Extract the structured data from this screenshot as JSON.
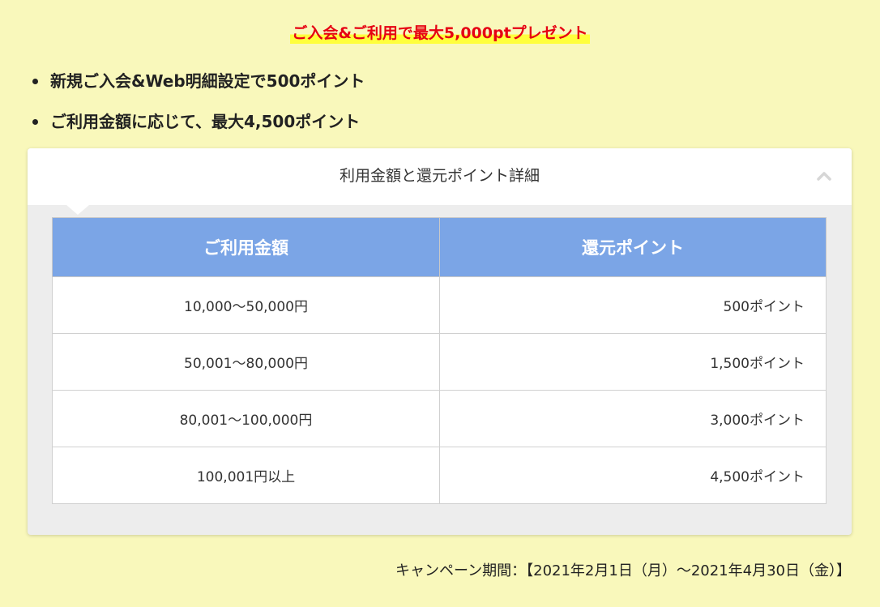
{
  "headline": "ご入会&ご利用で最大5,000ptプレゼント",
  "bullets": [
    "新規ご入会&Web明細設定で500ポイント",
    "ご利用金額に応じて、最大4,500ポイント"
  ],
  "accordion": {
    "title": "利用金額と還元ポイント詳細",
    "icon": "chevron-up-icon",
    "expanded": true
  },
  "table": {
    "headers": [
      "ご利用金額",
      "還元ポイント"
    ],
    "rows": [
      [
        "10,000～50,000円",
        "500ポイント"
      ],
      [
        "50,001～80,000円",
        "1,500ポイント"
      ],
      [
        "80,001～100,000円",
        "3,000ポイント"
      ],
      [
        "100,001円以上",
        "4,500ポイント"
      ]
    ]
  },
  "campaign_period": "キャンペーン期間：【2021年2月1日（月）～2021年4月30日（金）】",
  "colors": {
    "background": "#f9f8bb",
    "headline": "#e60012",
    "highlight": "#ffff3c",
    "table_header": "#7ba5e6",
    "panel": "#ededed"
  }
}
